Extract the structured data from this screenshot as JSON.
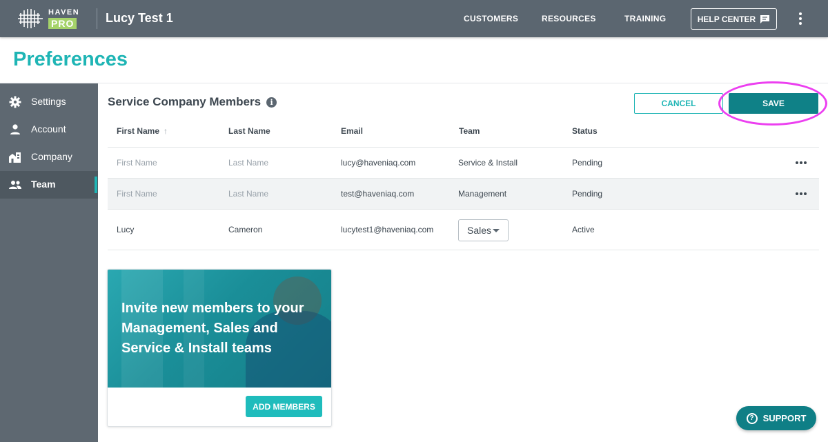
{
  "header": {
    "logo_top": "HAVEN",
    "logo_bottom": "PRO",
    "company_name": "Lucy Test 1",
    "nav": [
      "CUSTOMERS",
      "RESOURCES",
      "TRAINING"
    ],
    "help_center": "HELP CENTER",
    "icons": {
      "logo": "haven-logo-mark",
      "help": "chat-icon",
      "more": "kebab-menu-icon"
    }
  },
  "page": {
    "title": "Preferences"
  },
  "sidebar": {
    "items": [
      {
        "label": "Settings",
        "icon": "gear-icon",
        "active": false
      },
      {
        "label": "Account",
        "icon": "person-icon",
        "active": false
      },
      {
        "label": "Company",
        "icon": "building-icon",
        "active": false
      },
      {
        "label": "Team",
        "icon": "people-icon",
        "active": true
      }
    ]
  },
  "members": {
    "title": "Service Company Members",
    "info_icon": "i",
    "cancel_label": "CANCEL",
    "save_label": "SAVE",
    "columns": [
      "First Name",
      "Last Name",
      "Email",
      "Team",
      "Status"
    ],
    "sort_indicator": "↑",
    "rows": [
      {
        "first": "First Name",
        "last": "Last Name",
        "email": "lucy@haveniaq.com",
        "team": "Service & Install",
        "status": "Pending",
        "placeholder": true
      },
      {
        "first": "First Name",
        "last": "Last Name",
        "email": "test@haveniaq.com",
        "team": "Management",
        "status": "Pending",
        "placeholder": true
      },
      {
        "first": "Lucy",
        "last": "Cameron",
        "email": "lucytest1@haveniaq.com",
        "team": "Sales",
        "status": "Active",
        "placeholder": false
      }
    ]
  },
  "invite_card": {
    "text": "Invite new members to your Management, Sales and Service & Install teams",
    "button": "ADD MEMBERS"
  },
  "support": {
    "label": "SUPPORT",
    "icon": "question-circle-icon"
  },
  "colors": {
    "accent": "#1fb5b5",
    "primary_button": "#0f8187",
    "topbar": "#5b6670",
    "sidebar": "#5e6871",
    "highlight": "#ec3ff0"
  }
}
